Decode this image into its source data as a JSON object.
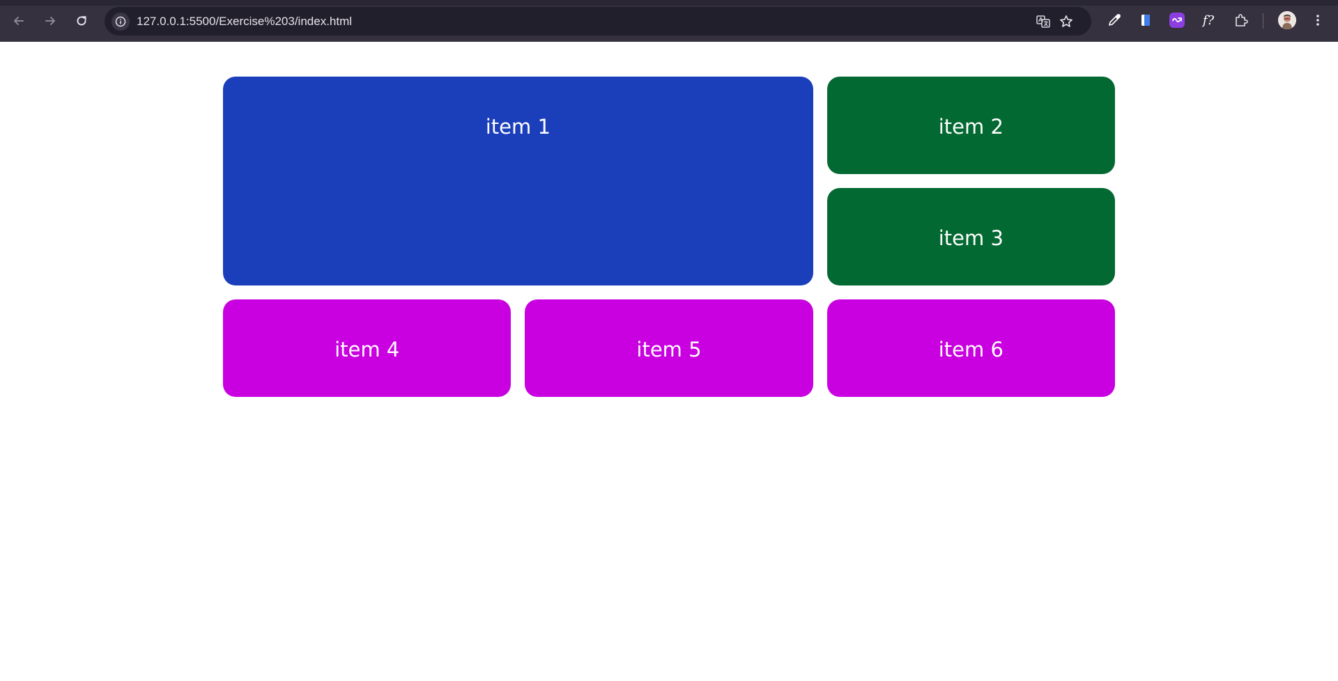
{
  "browser": {
    "url": "127.0.0.1:5500/Exercise%203/index.html",
    "icons": {
      "back": "arrow-left-icon",
      "forward": "arrow-right-icon",
      "reload": "reload-icon",
      "site_info": "info-icon",
      "translate": "translate-icon",
      "bookmark": "star-icon",
      "eyedropper": "eyedropper-icon",
      "extension_doc": "document-icon",
      "extension_purple": "purple-extension-icon",
      "extension_fx": "fx-icon",
      "extensions": "puzzle-icon",
      "profile": "avatar",
      "menu": "kebab-menu-icon"
    },
    "fx_label": "f?"
  },
  "page": {
    "items": [
      {
        "label": "item 1",
        "color": "#1b3fba"
      },
      {
        "label": "item 2",
        "color": "#036932"
      },
      {
        "label": "item 3",
        "color": "#036932"
      },
      {
        "label": "item 4",
        "color": "#c900df"
      },
      {
        "label": "item 5",
        "color": "#c900df"
      },
      {
        "label": "item 6",
        "color": "#c900df"
      }
    ]
  }
}
